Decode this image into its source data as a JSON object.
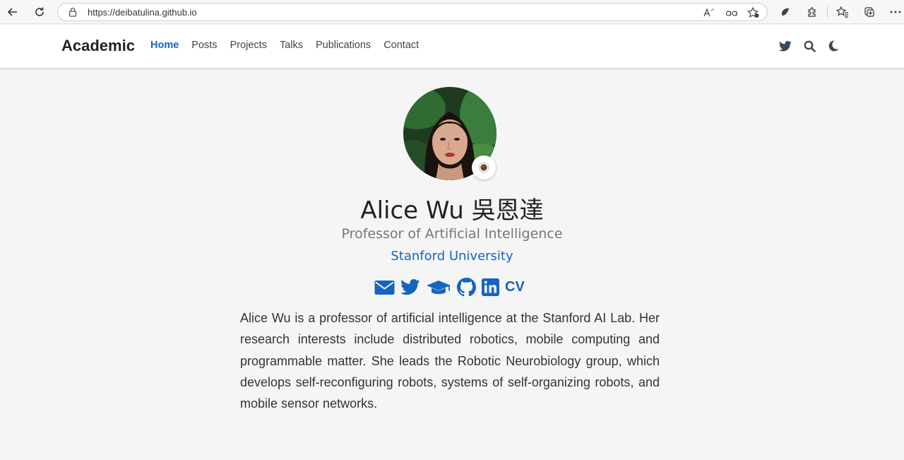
{
  "browser": {
    "url": "https://deibatulina.github.io"
  },
  "site": {
    "brand": "Academic",
    "menu": [
      {
        "label": "Home"
      },
      {
        "label": "Posts"
      },
      {
        "label": "Projects"
      },
      {
        "label": "Talks"
      },
      {
        "label": "Publications"
      },
      {
        "label": "Contact"
      }
    ],
    "nav_icons": [
      "twitter-icon",
      "search-icon",
      "moon-icon"
    ]
  },
  "profile": {
    "name": "Alice Wu 吳恩達",
    "role": "Professor of Artificial Intelligence",
    "organization": "Stanford University",
    "social_icons": [
      "envelope-icon",
      "twitter-icon",
      "graduation-cap-icon",
      "github-icon",
      "linkedin-icon"
    ],
    "cv_label": "CV",
    "bio": "Alice Wu is a professor of artificial intelligence at the Stanford AI Lab. Her research interests include distributed robotics, mobile computing and programmable matter. She leads the Robotic Neurobiology group, which develops self-reconfiguring robots, systems of self-organizing robots, and mobile sensor networks."
  },
  "colors": {
    "accent": "#1565c0",
    "page_bg": "#f5f5f5",
    "nav_icon": "#3b4a57"
  }
}
